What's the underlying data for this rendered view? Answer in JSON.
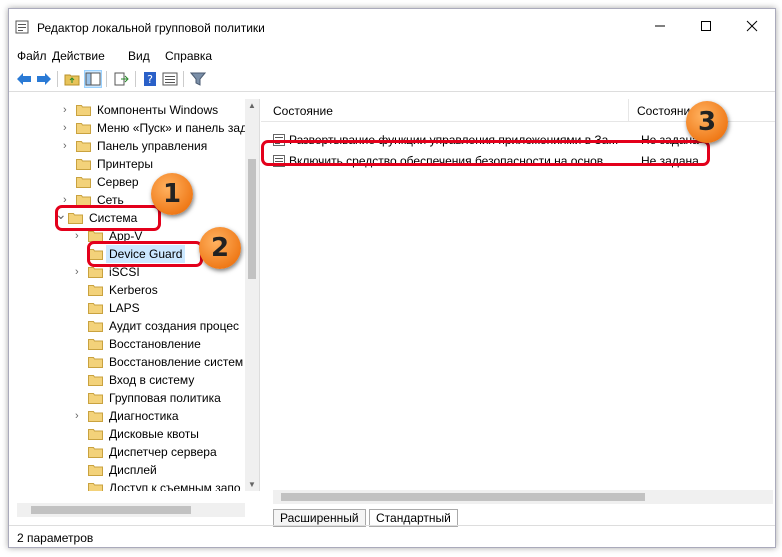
{
  "window": {
    "title": "Редактор локальной групповой политики"
  },
  "menu": [
    "Файл",
    "Действие",
    "Вид",
    "Справка"
  ],
  "toolbar": {
    "icons": [
      "back-arrow-icon",
      "forward-arrow-icon",
      "up-folder-icon",
      "show-hide-tree-icon",
      "export-list-icon",
      "help-icon",
      "properties-icon",
      "filter-icon"
    ]
  },
  "tree": {
    "items": [
      {
        "label": "Компоненты Windows",
        "expandable": true
      },
      {
        "label": "Меню «Пуск» и панель зад",
        "expandable": true
      },
      {
        "label": "Панель управления",
        "expandable": true
      },
      {
        "label": "Принтеры",
        "expandable": false
      },
      {
        "label": "Сервер",
        "expandable": false
      },
      {
        "label": "Сеть",
        "expandable": true
      },
      {
        "label": "Система",
        "expandable": true,
        "expanded": true
      },
      {
        "label": "App-V",
        "expandable": true
      },
      {
        "label": "Device Guard",
        "expandable": false,
        "selected": true
      },
      {
        "label": "iSCSI",
        "expandable": true
      },
      {
        "label": "Kerberos",
        "expandable": false
      },
      {
        "label": "LAPS",
        "expandable": false
      },
      {
        "label": "Аудит создания процес",
        "expandable": false
      },
      {
        "label": "Восстановление",
        "expandable": false
      },
      {
        "label": "Восстановление систем",
        "expandable": false
      },
      {
        "label": "Вход в систему",
        "expandable": false
      },
      {
        "label": "Групповая политика",
        "expandable": false
      },
      {
        "label": "Диагностика",
        "expandable": true
      },
      {
        "label": "Дисковые квоты",
        "expandable": false
      },
      {
        "label": "Диспетчер сервера",
        "expandable": false
      },
      {
        "label": "Дисплей",
        "expandable": false
      },
      {
        "label": "Доступ к съемным запо",
        "expandable": false
      }
    ]
  },
  "list": {
    "columns": [
      "Состояние",
      "Состояние"
    ],
    "rows": [
      {
        "name": "Развертывание функции управления приложениями в За...",
        "state": "Не задана"
      },
      {
        "name": "Включить средство обеспечения безопасности на основ...",
        "state": "Не задана"
      }
    ]
  },
  "tabs": [
    "Расширенный",
    "Стандартный"
  ],
  "status": "2 параметров",
  "callouts": [
    "1",
    "2",
    "3"
  ],
  "colors": {
    "callout_border": "#e3001b",
    "badge": "#f07b1a",
    "selection": "#cce8ff"
  }
}
